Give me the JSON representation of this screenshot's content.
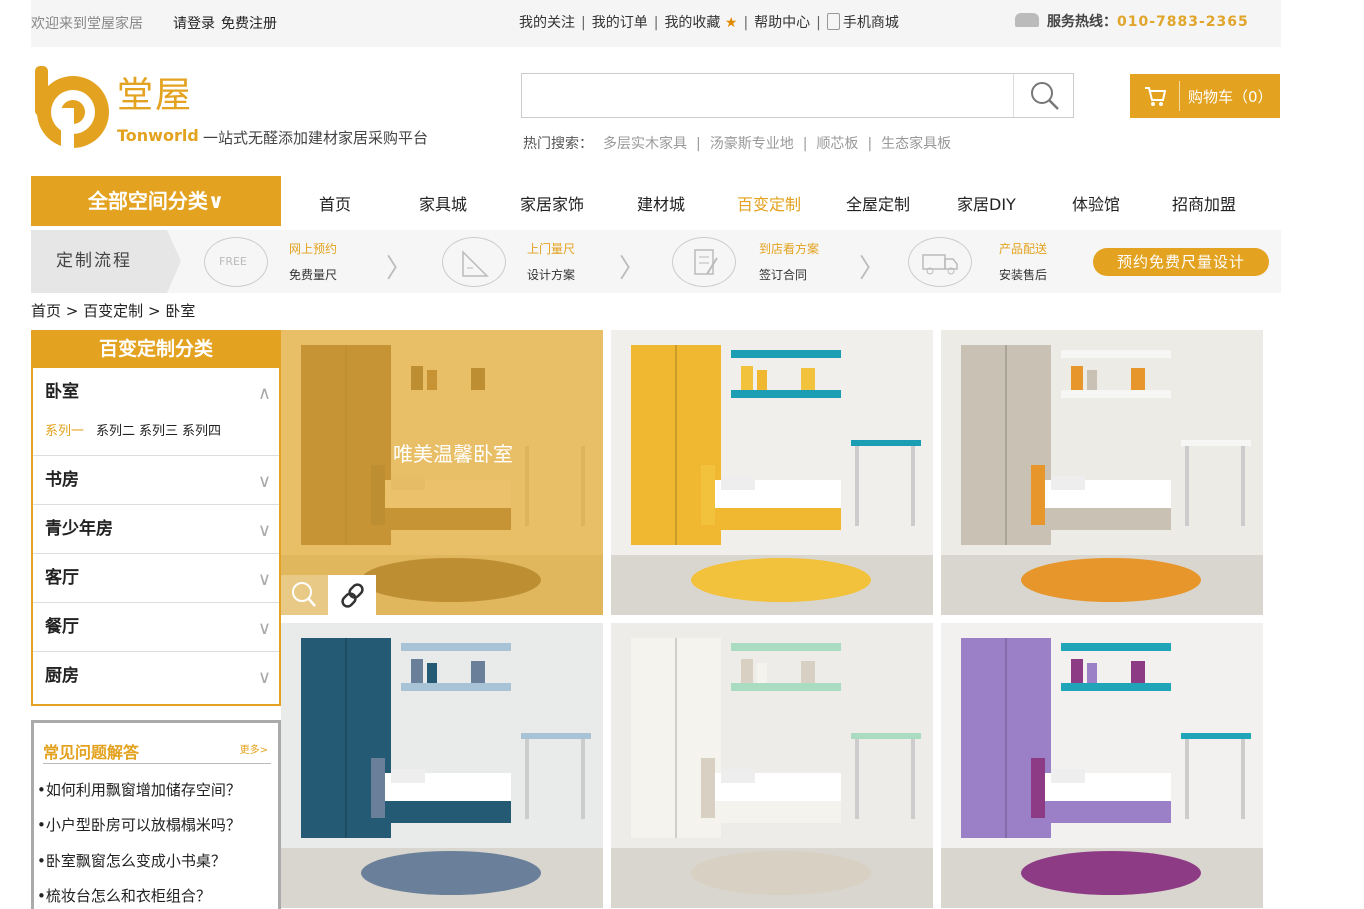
{
  "topbar": {
    "welcome": "欢迎来到堂屋家居",
    "login": "请登录",
    "register": "免费注册",
    "links": [
      "我的关注",
      "我的订单",
      "我的收藏",
      "帮助中心",
      "手机商城"
    ],
    "hotline_label": "服务热线：",
    "hotline_number": "010-7883-2365"
  },
  "logo": {
    "name_cn": "堂屋",
    "name_en": "Tonworld",
    "slogan": "一站式无醛添加建材家居采购平台"
  },
  "search": {
    "value": "",
    "placeholder": "",
    "hot_label": "热门搜索：",
    "hot_keywords": [
      "多层实木家具",
      "汤豪斯专业地",
      "顺芯板",
      "生态家具板"
    ]
  },
  "cart": {
    "label": "购物车（0）"
  },
  "nav": {
    "all_categories": "全部空间分类∨",
    "items": [
      "首页",
      "家具城",
      "家居家饰",
      "建材城",
      "百变定制",
      "全屋定制",
      "家居DIY",
      "体验馆",
      "招商加盟"
    ],
    "active": "百变定制"
  },
  "process": {
    "label": "定制流程",
    "steps": [
      {
        "icon": "free-icon",
        "title": "网上预约",
        "sub": "免费量尺",
        "icon_text": "FREE"
      },
      {
        "icon": "ruler-icon",
        "title": "上门量尺",
        "sub": "设计方案",
        "icon_text": ""
      },
      {
        "icon": "contract-icon",
        "title": "到店看方案",
        "sub": "签订合同",
        "icon_text": ""
      },
      {
        "icon": "truck-icon",
        "title": "产品配送",
        "sub": "安装售后",
        "icon_text": ""
      }
    ],
    "button": "预约免费尺量设计"
  },
  "breadcrumb": {
    "items": [
      "首页",
      "百变定制",
      "卧室"
    ],
    "separator": ">"
  },
  "sidebar": {
    "title": "百变定制分类",
    "categories": [
      {
        "label": "卧室",
        "open": true,
        "series": [
          "系列一",
          "系列二",
          "系列三",
          "系列四"
        ]
      },
      {
        "label": "书房"
      },
      {
        "label": "青少年房"
      },
      {
        "label": "客厅"
      },
      {
        "label": "餐厅"
      },
      {
        "label": "厨房"
      }
    ]
  },
  "faq": {
    "title": "常见问题解答",
    "more": "更多>",
    "questions": [
      "•如何利用飘窗增加储存空间？",
      "•小户型卧房可以放榻榻米吗？",
      "•卧室飘窗怎么变成小书桌？",
      "•梳妆台怎么和衣柜组合？"
    ]
  },
  "gallery": {
    "hover_caption": "唯美温馨卧室",
    "accent": "#e3a21f",
    "tiles": [
      {
        "name": "bedroom-1",
        "palette": [
          "#f2f2ee",
          "#7a5c3c",
          "#f4f4f0",
          "#5d4636"
        ]
      },
      {
        "name": "bedroom-2",
        "palette": [
          "#f0efec",
          "#f0b830",
          "#1b9eb3",
          "#f2c23c"
        ]
      },
      {
        "name": "bedroom-3",
        "palette": [
          "#ecebe6",
          "#c9c1b4",
          "#f6f6f4",
          "#e6962a"
        ]
      },
      {
        "name": "bedroom-4",
        "palette": [
          "#e9eaea",
          "#245a74",
          "#a9c3d6",
          "#6a7f99"
        ]
      },
      {
        "name": "bedroom-5",
        "palette": [
          "#eeece8",
          "#f4f3ee",
          "#a9dcc0",
          "#d8d0c2"
        ]
      },
      {
        "name": "bedroom-6",
        "palette": [
          "#f2f1ef",
          "#9b7fc7",
          "#1fa4b8",
          "#8e3b86"
        ]
      }
    ]
  }
}
